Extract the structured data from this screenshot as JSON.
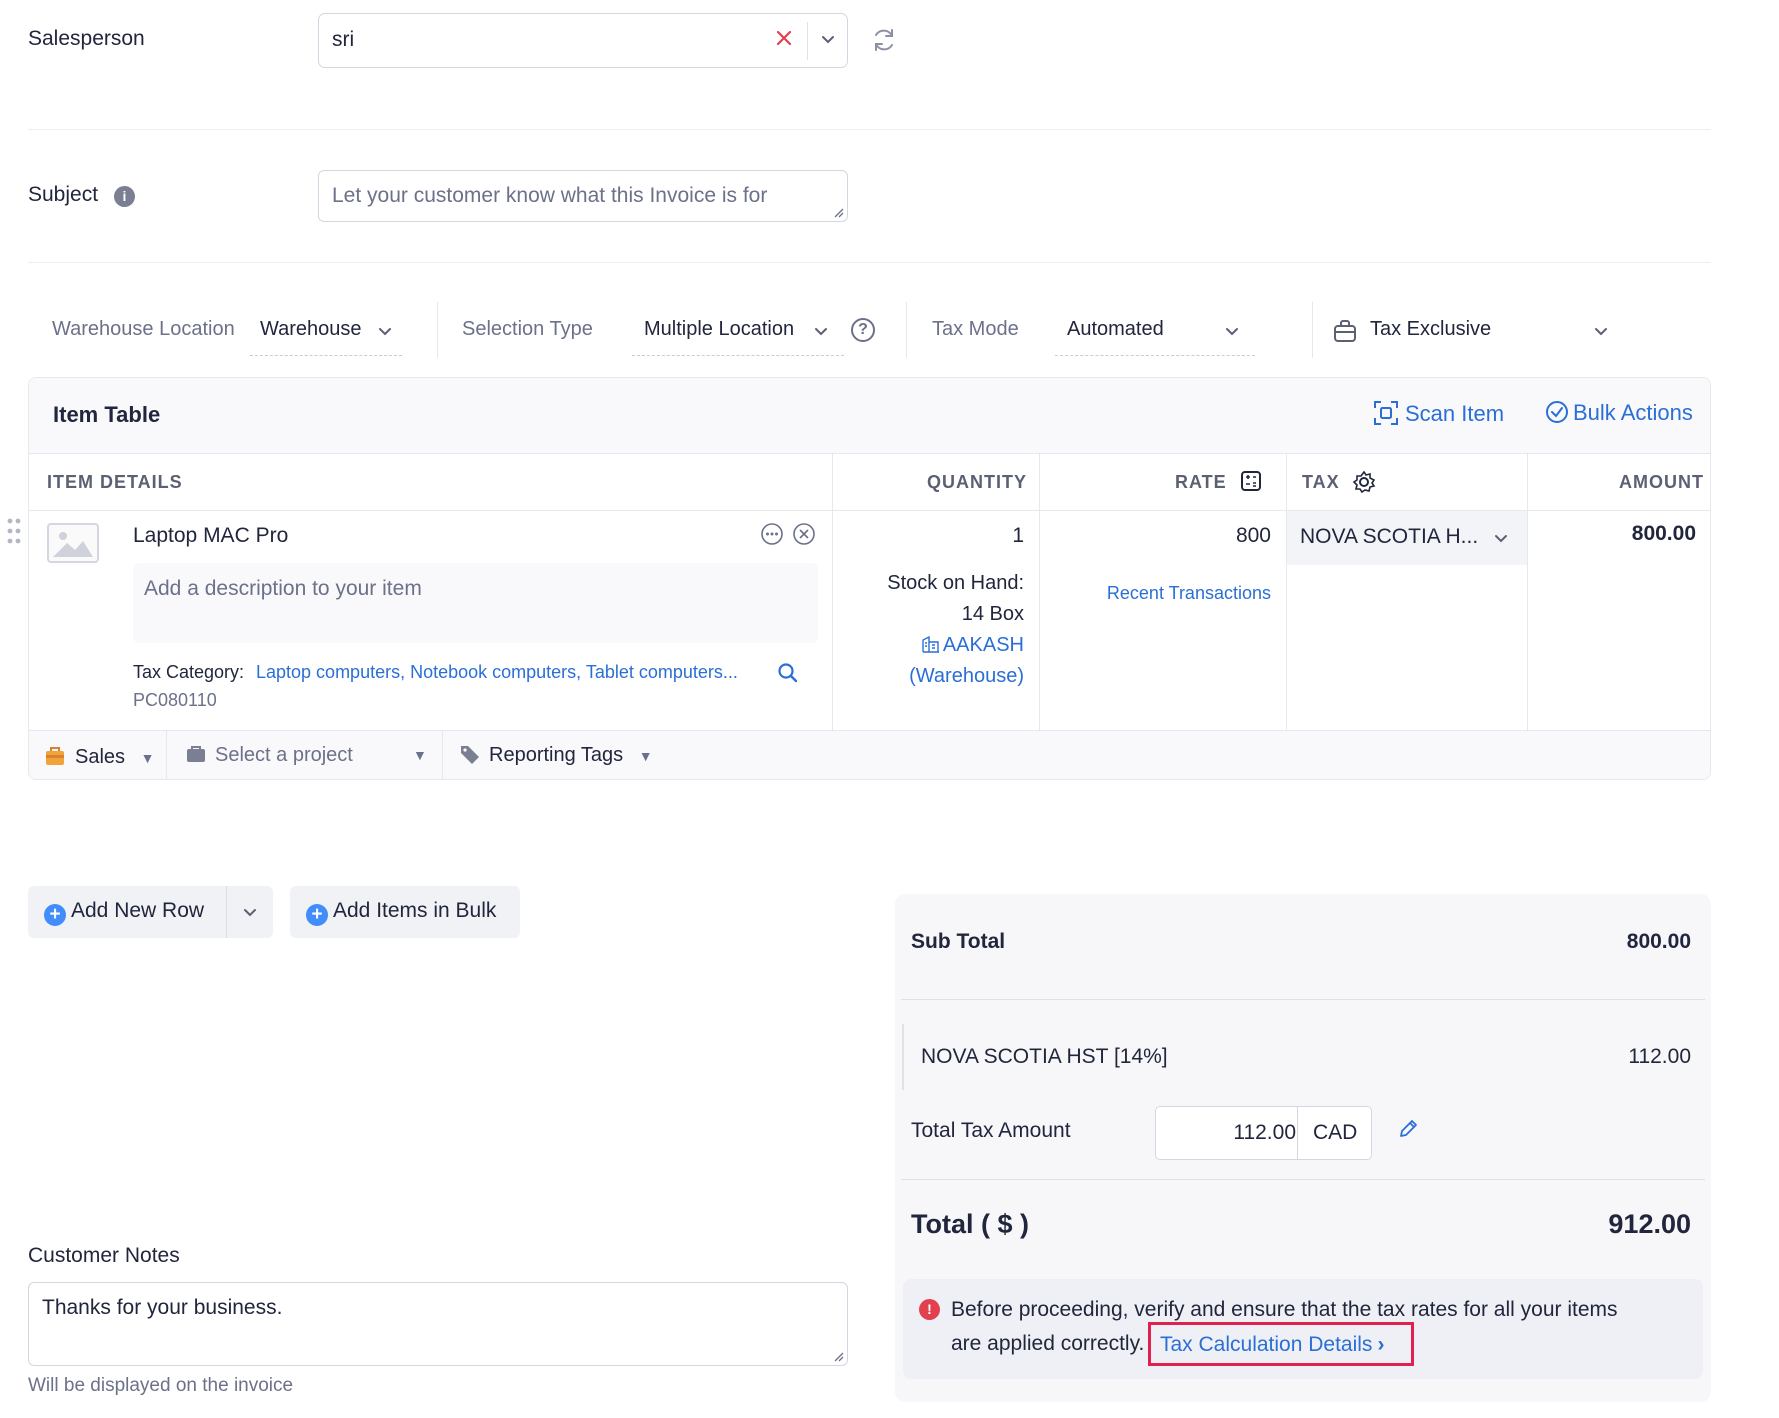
{
  "salesperson": {
    "label": "Salesperson",
    "value": "sri"
  },
  "subject": {
    "label": "Subject",
    "placeholder": "Let your customer know what this Invoice is for"
  },
  "toolbar": {
    "warehouse_label": "Warehouse Location",
    "warehouse_value": "Warehouse",
    "selection_label": "Selection Type",
    "selection_value": "Multiple Location",
    "tax_mode_label": "Tax Mode",
    "tax_mode_value": "Automated",
    "tax_type_value": "Tax Exclusive"
  },
  "item_table": {
    "title": "Item Table",
    "scan_label": "Scan Item",
    "bulk_label": "Bulk Actions",
    "columns": {
      "item": "ITEM DETAILS",
      "quantity": "QUANTITY",
      "rate": "RATE",
      "tax": "TAX",
      "amount": "AMOUNT"
    },
    "row": {
      "name": "Laptop MAC Pro",
      "description_placeholder": "Add a description to your item",
      "tax_category_label": "Tax Category:",
      "tax_category_value": "Laptop computers, Notebook computers, Tablet computers...",
      "tax_code": "PC080110",
      "quantity": "1",
      "stock_label": "Stock on Hand:",
      "stock_value": "14 Box",
      "stock_location": "AAKASH",
      "stock_location_type": "(Warehouse)",
      "rate": "800",
      "recent_transactions": "Recent Transactions",
      "tax": "NOVA SCOTIA H...",
      "amount": "800.00"
    },
    "footer": {
      "account": "Sales",
      "project_placeholder": "Select a project",
      "reporting_tags": "Reporting Tags"
    }
  },
  "actions": {
    "add_row": "Add New Row",
    "add_bulk": "Add Items in Bulk"
  },
  "summary": {
    "subtotal_label": "Sub Total",
    "subtotal_value": "800.00",
    "tax_line_label": "NOVA SCOTIA HST [14%]",
    "tax_line_value": "112.00",
    "total_tax_label": "Total Tax Amount",
    "total_tax_value": "112.00",
    "currency": "CAD",
    "total_label": "Total ( $ )",
    "total_value": "912.00",
    "notice_text_1": "Before proceeding, verify and ensure that the tax rates for all your items",
    "notice_text_2": "are applied correctly.",
    "notice_link": "Tax Calculation Details"
  },
  "customer_notes": {
    "label": "Customer Notes",
    "value": "Thanks for your business.",
    "hint": "Will be displayed on the invoice"
  },
  "colors": {
    "accent": "#2a6fd6",
    "danger": "#e2404f",
    "highlight": "#e0214f"
  }
}
